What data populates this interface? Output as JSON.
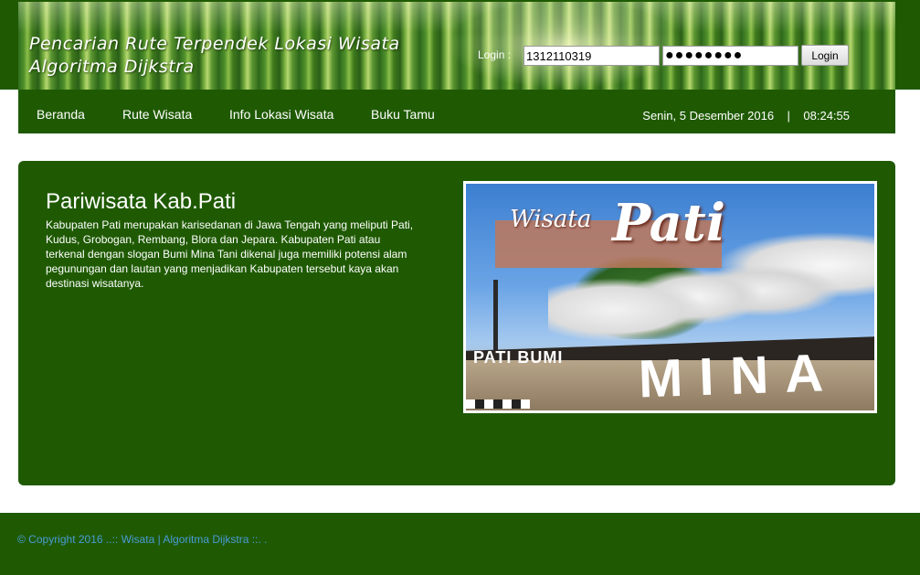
{
  "header": {
    "title_line1": "Pencarian Rute Terpendek Lokasi Wisata",
    "title_line2": "Algoritma Dijkstra",
    "login_label": "Login :",
    "username_value": "1312110319",
    "password_value": "●●●●●●●●",
    "login_button": "Login"
  },
  "nav": {
    "items": [
      {
        "label": "Beranda"
      },
      {
        "label": "Rute Wisata"
      },
      {
        "label": "Info Lokasi Wisata"
      },
      {
        "label": "Buku Tamu"
      }
    ],
    "date": "Senin, 5 Desember 2016",
    "separator": "|",
    "time": "08:24:55"
  },
  "content": {
    "title": "Pariwisata Kab.Pati",
    "text": "Kabupaten Pati merupakan karisedanan di Jawa Tengah yang meliputi Pati, Kudus, Grobogan, Rembang, Blora dan Jepara. Kabupaten Pati atau terkenal dengan slogan Bumi Mina Tani dikenal juga memiliki potensi alam pegunungan dan lautan yang menjadikan Kabupaten tersebut kaya akan destinasi wisatanya.",
    "image": {
      "script_small": "Wisata",
      "script_big": "Pati",
      "sign_small": "PATI BUMI",
      "sign_big": "MINA TANI"
    }
  },
  "footer": {
    "text": "© Copyright 2016 ..:: Wisata | Algoritma Dijkstra ::. ."
  }
}
